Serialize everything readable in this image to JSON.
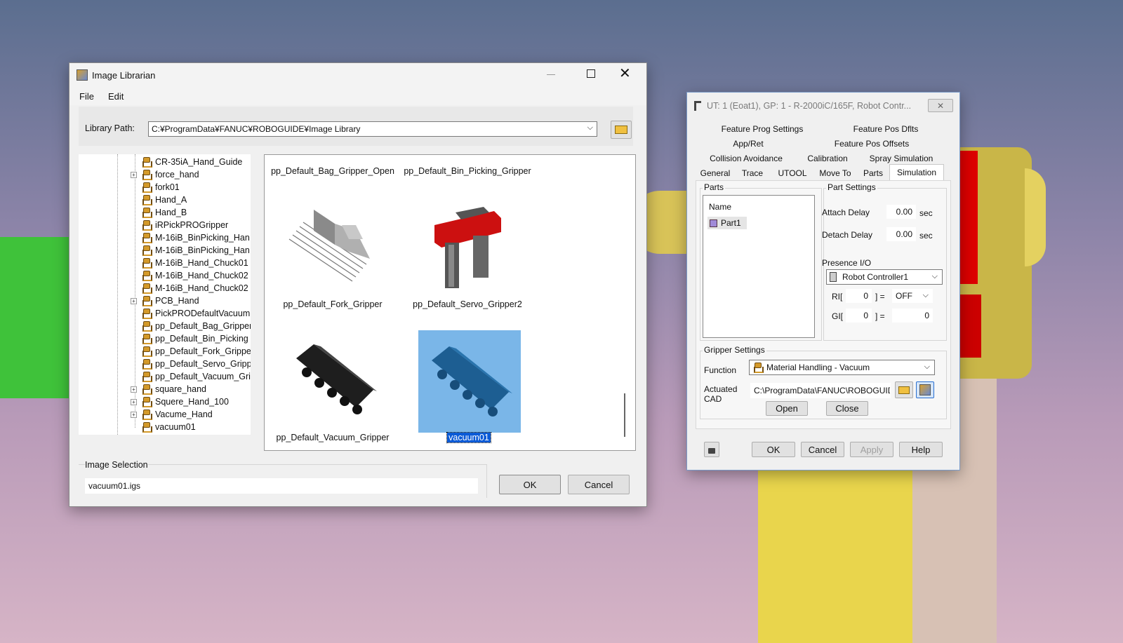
{
  "librarian": {
    "title": "Image Librarian",
    "menu": [
      "File",
      "Edit"
    ],
    "path_label": "Library Path:",
    "path_value": "C:¥ProgramData¥FANUC¥ROBOGUIDE¥Image Library",
    "tree": [
      {
        "label": "CR-35iA_Hand_Guide",
        "exp": false
      },
      {
        "label": "force_hand",
        "exp": true
      },
      {
        "label": "fork01",
        "exp": false
      },
      {
        "label": "Hand_A",
        "exp": false
      },
      {
        "label": "Hand_B",
        "exp": false
      },
      {
        "label": "iRPickPROGripper",
        "exp": false
      },
      {
        "label": "M-16iB_BinPicking_Han",
        "exp": false
      },
      {
        "label": "M-16iB_BinPicking_Han",
        "exp": false
      },
      {
        "label": "M-16iB_Hand_Chuck01",
        "exp": false
      },
      {
        "label": "M-16iB_Hand_Chuck02",
        "exp": false
      },
      {
        "label": "M-16iB_Hand_Chuck02",
        "exp": false
      },
      {
        "label": "PCB_Hand",
        "exp": true
      },
      {
        "label": "PickPRODefaultVacuum",
        "exp": false
      },
      {
        "label": "pp_Default_Bag_Gripper",
        "exp": false
      },
      {
        "label": "pp_Default_Bin_Picking",
        "exp": false
      },
      {
        "label": "pp_Default_Fork_Grippe",
        "exp": false
      },
      {
        "label": "pp_Default_Servo_Gripp",
        "exp": false
      },
      {
        "label": "pp_Default_Vacuum_Gri",
        "exp": false
      },
      {
        "label": "square_hand",
        "exp": true
      },
      {
        "label": "Squere_Hand_100",
        "exp": true
      },
      {
        "label": "Vacume_Hand",
        "exp": true
      },
      {
        "label": "vacuum01",
        "exp": false
      }
    ],
    "thumbs": [
      "pp_Default_Bag_Gripper_Open",
      "pp_Default_Bin_Picking_Gripper",
      "pp_Default_Fork_Gripper",
      "pp_Default_Servo_Gripper2",
      "pp_Default_Vacuum_Gripper",
      "vacuum01"
    ],
    "selection_label": "Image Selection",
    "selection_value": "vacuum01.igs",
    "ok": "OK",
    "cancel": "Cancel"
  },
  "ut": {
    "title": "UT: 1  (Eoat1), GP: 1 - R-2000iC/165F, Robot Contr...",
    "tabs_row1": [
      "Feature Prog Settings",
      "Feature Pos Dflts"
    ],
    "tabs_row2": [
      "App/Ret",
      "Feature Pos Offsets"
    ],
    "tabs_row3": [
      "Collision Avoidance",
      "Calibration",
      "Spray Simulation"
    ],
    "tabs_row4": [
      "General",
      "Trace",
      "UTOOL",
      "Move To",
      "Parts",
      "Simulation"
    ],
    "parts_group": "Parts",
    "parts_header": "Name",
    "parts_item": "Part1",
    "part_settings": "Part Settings",
    "attach_label": "Attach Delay",
    "attach_value": "0.00",
    "attach_unit": "sec",
    "detach_label": "Detach Delay",
    "detach_value": "0.00",
    "detach_unit": "sec",
    "presence_label": "Presence I/O",
    "controller": "Robot Controller1",
    "ri_label": "RI[",
    "ri_value": "0",
    "ri_eq": "] =",
    "ri_state": "OFF",
    "gi_label": "GI[",
    "gi_value": "0",
    "gi_eq": "] =",
    "gi_state": "0",
    "gripper_group": "Gripper Settings",
    "function_label": "Function",
    "function_value": "Material Handling - Vacuum",
    "cad_label1": "Actuated",
    "cad_label2": "CAD",
    "cad_value": "C:\\ProgramData\\FANUC\\ROBOGUID",
    "open": "Open",
    "close": "Close",
    "ok": "OK",
    "cancel": "Cancel",
    "apply": "Apply",
    "help": "Help"
  }
}
